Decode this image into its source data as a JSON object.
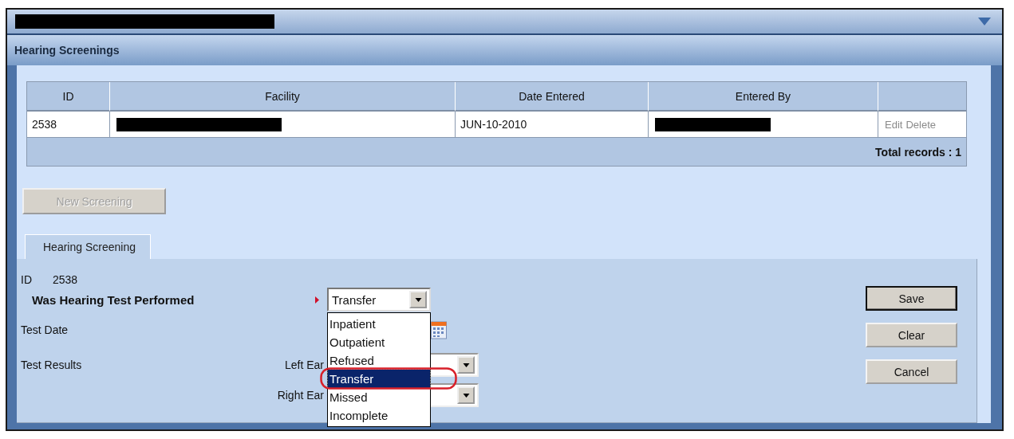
{
  "section": {
    "title": "Hearing Screenings"
  },
  "table": {
    "columns": [
      "ID",
      "Facility",
      "Date Entered",
      "Entered By"
    ],
    "rows": [
      {
        "id": "2538",
        "date": "JUN-10-2010",
        "actions": [
          {
            "label": "Edit",
            "disabled": true
          },
          {
            "label": "Delete",
            "disabled": true
          }
        ]
      }
    ],
    "total": "Total records : 1"
  },
  "new_button": {
    "label": "New Screening",
    "disabled": true
  },
  "tabs": [
    {
      "label": "Hearing Screening",
      "selected": true
    }
  ],
  "form": {
    "id_label": "ID",
    "id_value": "2538",
    "performed": {
      "label": "Was Hearing Test Performed",
      "required": true,
      "value": "Transfer",
      "expanded": true,
      "options": [
        {
          "label": "Inpatient",
          "selected": false
        },
        {
          "label": "Outpatient",
          "selected": false
        },
        {
          "label": "Refused",
          "selected": false
        },
        {
          "label": "Transfer",
          "selected": true
        },
        {
          "label": "Missed",
          "selected": false
        },
        {
          "label": "Incomplete",
          "selected": false
        }
      ]
    },
    "test_date": {
      "label": "Test Date"
    },
    "test_results": {
      "label": "Test Results",
      "left_ear": "Left Ear",
      "right_ear": "Right Ear"
    }
  },
  "buttons": [
    {
      "label": "Save",
      "default": true
    },
    {
      "label": "Clear",
      "default": false
    },
    {
      "label": "Cancel",
      "default": false
    }
  ]
}
